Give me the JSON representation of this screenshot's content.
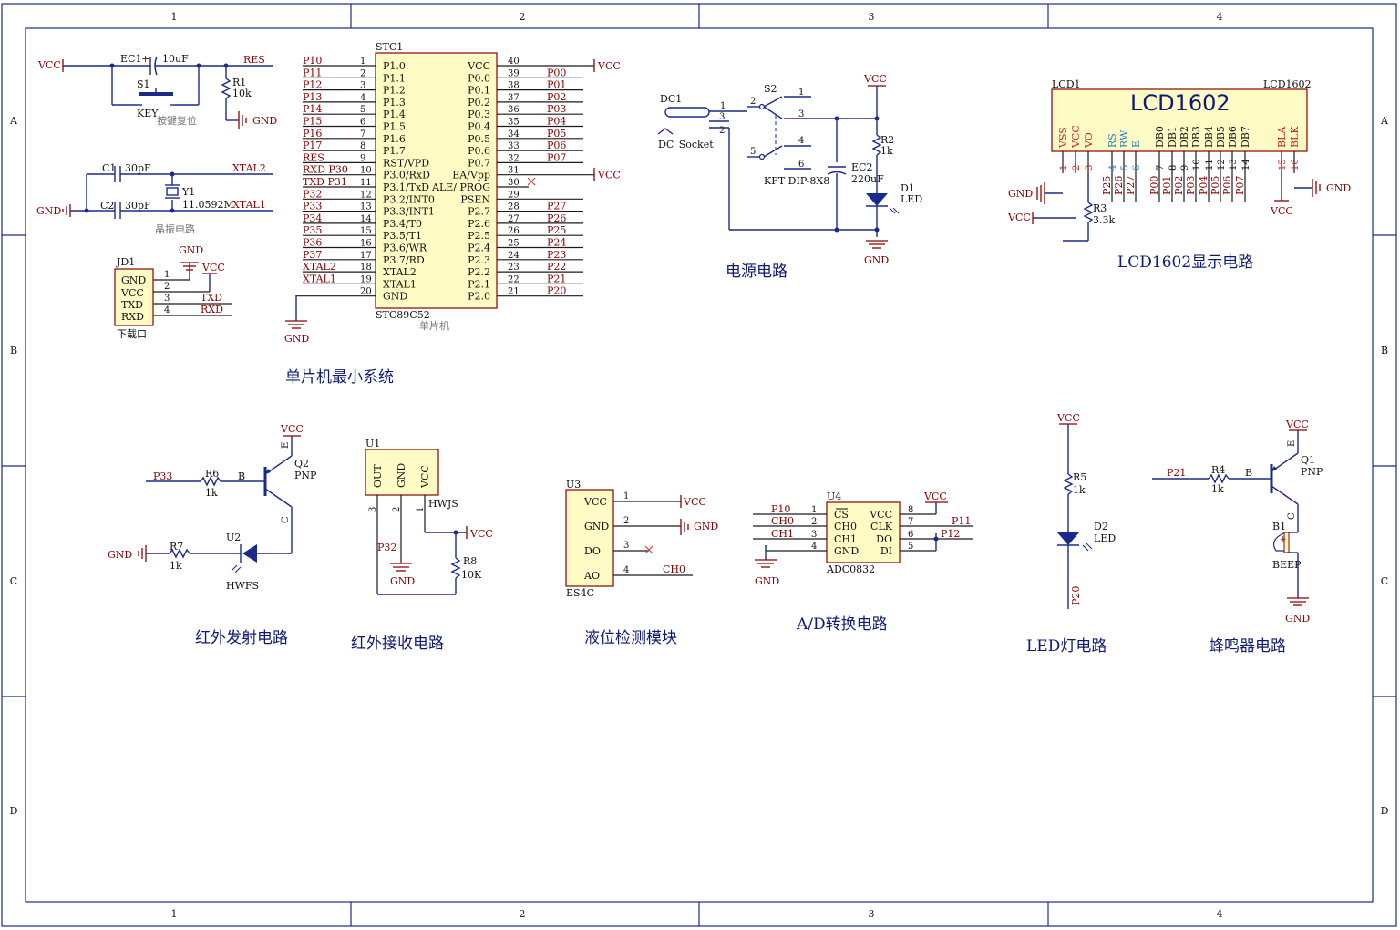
{
  "grid": {
    "cols": [
      "1",
      "2",
      "3",
      "4"
    ],
    "rows": [
      "A",
      "B",
      "C",
      "D"
    ]
  },
  "mcu": {
    "designator": "STC1",
    "part": "STC89C52",
    "comment": "单片机",
    "left": [
      {
        "num": "1",
        "pin": "P1.0",
        "net": "P10"
      },
      {
        "num": "2",
        "pin": "P1.1",
        "net": "P11"
      },
      {
        "num": "3",
        "pin": "P1.2",
        "net": "P12"
      },
      {
        "num": "4",
        "pin": "P1.3",
        "net": "P13"
      },
      {
        "num": "5",
        "pin": "P1.4",
        "net": "P14"
      },
      {
        "num": "6",
        "pin": "P1.5",
        "net": "P15"
      },
      {
        "num": "7",
        "pin": "P1.6",
        "net": "P16"
      },
      {
        "num": "8",
        "pin": "P1.7",
        "net": "P17"
      },
      {
        "num": "9",
        "pin": "RST/VPD",
        "net": "RES"
      },
      {
        "num": "10",
        "pin": "P3.0/RxD",
        "net": "RXD P30"
      },
      {
        "num": "11",
        "pin": "P3.1/TxD",
        "net": "TXD P31"
      },
      {
        "num": "12",
        "pin": "P3.2/INT0",
        "net": "P32"
      },
      {
        "num": "13",
        "pin": "P3.3/INT1",
        "net": "P33"
      },
      {
        "num": "14",
        "pin": "P3.4/T0",
        "net": "P34"
      },
      {
        "num": "15",
        "pin": "P3.5/T1",
        "net": "P35"
      },
      {
        "num": "16",
        "pin": "P3.6/WR",
        "net": "P36"
      },
      {
        "num": "17",
        "pin": "P3.7/RD",
        "net": "P37"
      },
      {
        "num": "18",
        "pin": "XTAL2",
        "net": "XTAL2"
      },
      {
        "num": "19",
        "pin": "XTAL1",
        "net": "XTAL1"
      },
      {
        "num": "20",
        "pin": "GND",
        "net": ""
      }
    ],
    "right": [
      {
        "num": "40",
        "pin": "VCC",
        "net": "VCC"
      },
      {
        "num": "39",
        "pin": "P0.0",
        "net": "P00"
      },
      {
        "num": "38",
        "pin": "P0.1",
        "net": "P01"
      },
      {
        "num": "37",
        "pin": "P0.2",
        "net": "P02"
      },
      {
        "num": "36",
        "pin": "P0.3",
        "net": "P03"
      },
      {
        "num": "35",
        "pin": "P0.4",
        "net": "P04"
      },
      {
        "num": "34",
        "pin": "P0.5",
        "net": "P05"
      },
      {
        "num": "33",
        "pin": "P0.6",
        "net": "P06"
      },
      {
        "num": "32",
        "pin": "P0.7",
        "net": "P07"
      },
      {
        "num": "31",
        "pin": "EA/Vpp",
        "net": "VCC"
      },
      {
        "num": "30",
        "pin": "ALE/ PROG",
        "net": ""
      },
      {
        "num": "29",
        "pin": "PSEN",
        "net": ""
      },
      {
        "num": "28",
        "pin": "P2.7",
        "net": "P27"
      },
      {
        "num": "27",
        "pin": "P2.6",
        "net": "P26"
      },
      {
        "num": "26",
        "pin": "P2.5",
        "net": "P25"
      },
      {
        "num": "25",
        "pin": "P2.4",
        "net": "P24"
      },
      {
        "num": "24",
        "pin": "P2.3",
        "net": "P23"
      },
      {
        "num": "23",
        "pin": "P2.2",
        "net": "P22"
      },
      {
        "num": "22",
        "pin": "P2.1",
        "net": "P21"
      },
      {
        "num": "21",
        "pin": "P2.0",
        "net": "P20"
      }
    ],
    "gnd": "GND"
  },
  "reset": {
    "cap": "EC1",
    "cap_val": "10uF",
    "res": "R1",
    "res_val": "10k",
    "switch": "S1",
    "switch_part": "KEY",
    "comment": "按键复位",
    "vcc": "VCC",
    "net": "RES",
    "gnd": "GND",
    "plus": "+"
  },
  "crystal": {
    "c1": "C1",
    "c1_val": "30pF",
    "c2": "C2",
    "c2_val": "30pF",
    "xtal": "Y1",
    "xtal_val": "11.0592M",
    "comment": "晶振电路",
    "net2": "XTAL2",
    "net1": "XTAL1",
    "gnd": "GND"
  },
  "header": {
    "designator": "JD1",
    "pins": [
      {
        "num": "1",
        "name": "GND",
        "net": ""
      },
      {
        "num": "2",
        "name": "VCC",
        "net": ""
      },
      {
        "num": "3",
        "name": "TXD",
        "net": "TXD"
      },
      {
        "num": "4",
        "name": "RXD",
        "net": "RXD"
      }
    ],
    "gnd": "GND",
    "vcc": "VCC",
    "comment": "下载口"
  },
  "power": {
    "jack": "DC1",
    "jack_part": "DC_Socket",
    "switch": "S2",
    "switch_part": "KFT DIP-8X8",
    "cap": "EC2",
    "cap_val": "220uF",
    "res": "R2",
    "res_val": "1k",
    "led": "D1",
    "led_part": "LED",
    "vcc": "VCC",
    "gnd": "GND",
    "pins": [
      "1",
      "2",
      "3",
      "4",
      "5",
      "6",
      "1",
      "3",
      "2"
    ]
  },
  "lcd": {
    "designator_left": "LCD1",
    "designator_right": "LCD1602",
    "title": "LCD1602",
    "pins": [
      {
        "name": "VSS",
        "num": "1",
        "net": "",
        "col": "red"
      },
      {
        "name": "VCC",
        "num": "2",
        "net": "",
        "col": "red"
      },
      {
        "name": "VO",
        "num": "3",
        "net": "",
        "col": "red"
      },
      {
        "name": "RS",
        "num": "4",
        "net": "P25",
        "col": "blue"
      },
      {
        "name": "RW",
        "num": "5",
        "net": "P26",
        "col": "blue"
      },
      {
        "name": "E",
        "num": "6",
        "net": "P27",
        "col": "blue"
      },
      {
        "name": "DB0",
        "num": "7",
        "net": "P00",
        "col": "black"
      },
      {
        "name": "DB1",
        "num": "8",
        "net": "P01",
        "col": "black"
      },
      {
        "name": "DB2",
        "num": "9",
        "net": "P02",
        "col": "black"
      },
      {
        "name": "DB3",
        "num": "10",
        "net": "P03",
        "col": "black"
      },
      {
        "name": "DB4",
        "num": "11",
        "net": "P04",
        "col": "black"
      },
      {
        "name": "DB5",
        "num": "12",
        "net": "P05",
        "col": "black"
      },
      {
        "name": "DB6",
        "num": "13",
        "net": "P06",
        "col": "black"
      },
      {
        "name": "DB7",
        "num": "14",
        "net": "P07",
        "col": "black"
      },
      {
        "name": "BLA",
        "num": "15",
        "net": "VCC",
        "col": "red"
      },
      {
        "name": "BLK",
        "num": "16",
        "net": "",
        "col": "red"
      }
    ],
    "res": "R3",
    "res_val": "3.3k",
    "gnd": "GND",
    "vcc": "VCC"
  },
  "ir_tx": {
    "q": "Q2",
    "q_part": "PNP",
    "r6": "R6",
    "r6_val": "1k",
    "r7": "R7",
    "r7_val": "1k",
    "diode": "U2",
    "diode_part": "HWFS",
    "net": "P33",
    "vcc": "VCC",
    "gnd": "GND",
    "b": "B",
    "e": "E",
    "c": "C"
  },
  "ir_rx": {
    "designator": "U1",
    "part": "HWJS",
    "pins": [
      "OUT",
      "GND",
      "VCC"
    ],
    "pin_nums": [
      "3",
      "2",
      "1"
    ],
    "net": "P32",
    "res": "R8",
    "res_val": "10K",
    "vcc": "VCC",
    "gnd": "GND"
  },
  "level": {
    "designator": "U3",
    "part": "ES4C",
    "pins": [
      {
        "num": "1",
        "name": "VCC",
        "net": "VCC"
      },
      {
        "num": "2",
        "name": "GND",
        "net": "GND"
      },
      {
        "num": "3",
        "name": "DO",
        "net": ""
      },
      {
        "num": "4",
        "name": "AO",
        "net": "CH0"
      }
    ]
  },
  "adc": {
    "designator": "U4",
    "part": "ADC0832",
    "left": [
      {
        "num": "1",
        "name": "CS",
        "net": "P10"
      },
      {
        "num": "2",
        "name": "CH0",
        "net": "CH0"
      },
      {
        "num": "3",
        "name": "CH1",
        "net": "CH1"
      },
      {
        "num": "4",
        "name": "GND",
        "net": ""
      }
    ],
    "right": [
      {
        "num": "8",
        "name": "VCC",
        "net": "VCC"
      },
      {
        "num": "7",
        "name": "CLK",
        "net": "P11"
      },
      {
        "num": "6",
        "name": "DO",
        "net": "P12"
      },
      {
        "num": "5",
        "name": "DI",
        "net": ""
      }
    ],
    "gnd": "GND"
  },
  "led": {
    "res": "R5",
    "res_val": "1k",
    "led": "D2",
    "led_part": "LED",
    "vcc": "VCC",
    "net": "P20"
  },
  "buzzer": {
    "q": "Q1",
    "q_part": "PNP",
    "res": "R4",
    "res_val": "1k",
    "buzzer": "B1",
    "buzzer_part": "BEEP",
    "net": "P21",
    "vcc": "VCC",
    "gnd": "GND",
    "b": "B",
    "e": "E",
    "c": "C",
    "plus": "+"
  },
  "titles": {
    "mcu": "单片机最小系统",
    "power": "电源电路",
    "lcd": "LCD1602显示电路",
    "ir_tx": "红外发射电路",
    "ir_rx": "红外接收电路",
    "level": "液位检测模块",
    "adc": "A/D转换电路",
    "led": "LED灯电路",
    "buzzer": "蜂鸣器电路"
  }
}
